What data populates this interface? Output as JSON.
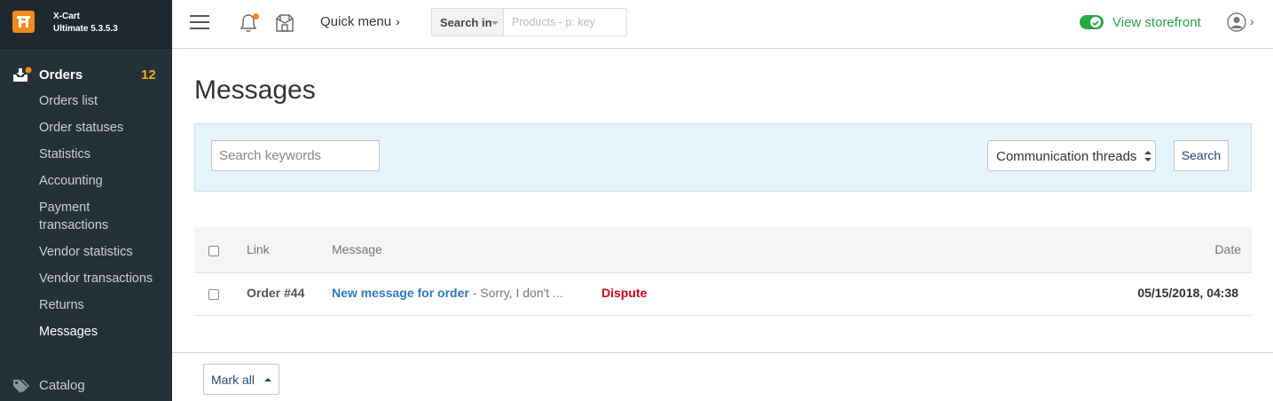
{
  "app": {
    "name": "X-Cart",
    "edition": "Ultimate 5.3.5.3"
  },
  "sidebar": {
    "orders": {
      "label": "Orders",
      "count": "12"
    },
    "items": [
      {
        "label": "Orders list"
      },
      {
        "label": "Order statuses"
      },
      {
        "label": "Statistics"
      },
      {
        "label": "Accounting"
      },
      {
        "label": "Payment transactions"
      },
      {
        "label": "Vendor statistics"
      },
      {
        "label": "Vendor transactions"
      },
      {
        "label": "Returns"
      },
      {
        "label": "Messages",
        "active": true
      }
    ],
    "catalog": {
      "label": "Catalog"
    }
  },
  "topbar": {
    "quick_menu": "Quick menu",
    "search_in_label": "Search in",
    "search_placeholder": "Products - p: key",
    "view_storefront": "View storefront"
  },
  "page": {
    "title": "Messages",
    "filters": {
      "keywords_placeholder": "Search keywords",
      "thread_select_value": "Communication threads",
      "search_button": "Search"
    },
    "table": {
      "columns": [
        "Link",
        "Message",
        "Date"
      ],
      "rows": [
        {
          "link": "Order #44",
          "message_title": "New message for order",
          "message_separator": " - ",
          "message_preview": "Sorry, I don't ...",
          "status": "Dispute",
          "date": "05/15/2018, 04:38"
        }
      ]
    },
    "mark_all_button": "Mark all"
  },
  "colors": {
    "sidebar_bg": "#243138",
    "accent_orange": "#f28c1e",
    "storefront_green": "#2aa04a",
    "link_blue": "#2f7abf",
    "dispute_red": "#d0021b",
    "filter_panel_bg": "#e6f4fc"
  },
  "icons": {
    "logo": "xcart-logo-icon",
    "orders": "orders-inbox-icon",
    "catalog": "tags-icon",
    "menu": "hamburger-icon",
    "notifications": "bell-icon",
    "storefront": "store-icon",
    "user": "user-avatar-icon"
  }
}
